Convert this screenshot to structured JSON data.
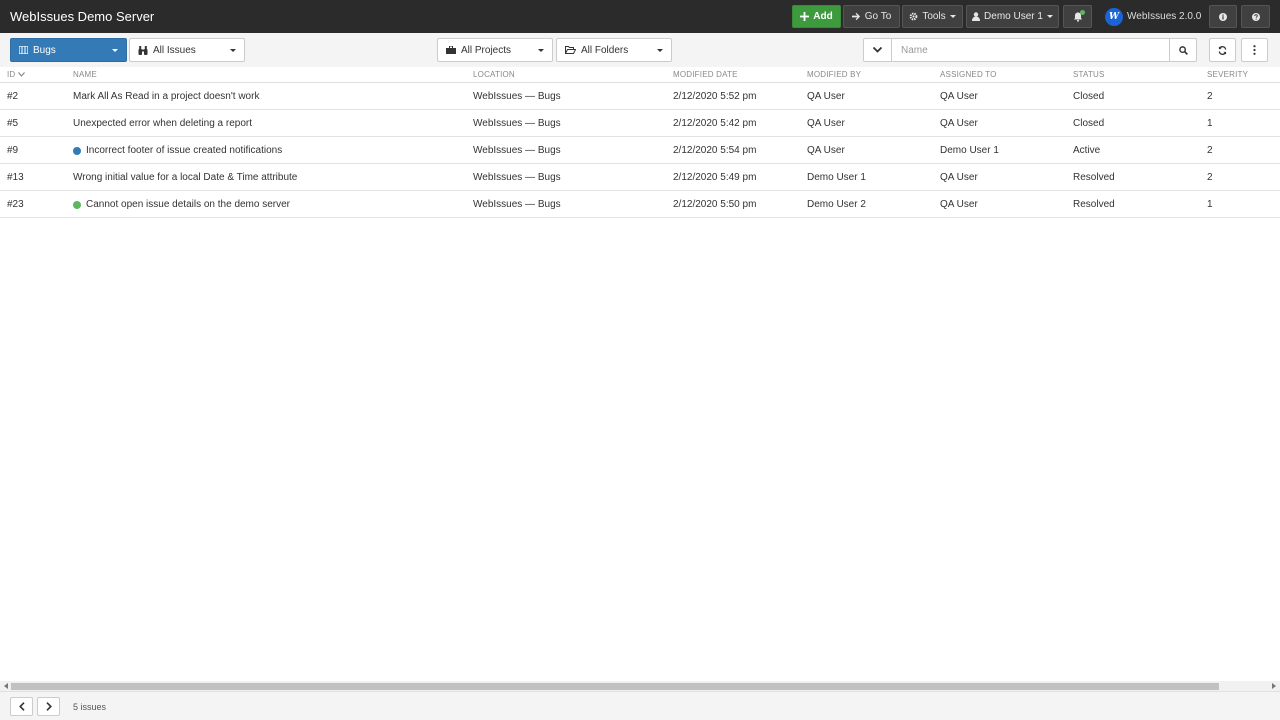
{
  "header": {
    "title": "WebIssues Demo Server",
    "add_label": "Add",
    "goto_label": "Go To",
    "tools_label": "Tools",
    "user_label": "Demo User 1",
    "brand_logo": "W",
    "brand_label": "WebIssues 2.0.0"
  },
  "toolbar": {
    "view_label": "Bugs",
    "filter_label": "All Issues",
    "projects_label": "All Projects",
    "folders_label": "All Folders",
    "search_placeholder": "Name"
  },
  "table": {
    "columns": {
      "id": "ID",
      "name": "Name",
      "location": "Location",
      "modified_date": "Modified Date",
      "modified_by": "Modified By",
      "assigned_to": "Assigned To",
      "status": "Status",
      "severity": "Severity"
    },
    "rows": [
      {
        "id": "#2",
        "name": "Mark All As Read in a project doesn't work",
        "location": "WebIssues — Bugs",
        "modified_date": "2/12/2020 5:52 pm",
        "modified_by": "QA User",
        "assigned_to": "QA User",
        "status": "Closed",
        "severity": "2"
      },
      {
        "id": "#5",
        "name": "Unexpected error when deleting a report",
        "location": "WebIssues — Bugs",
        "modified_date": "2/12/2020 5:42 pm",
        "modified_by": "QA User",
        "assigned_to": "QA User",
        "status": "Closed",
        "severity": "1"
      },
      {
        "id": "#9",
        "name": "Incorrect footer of issue created notifications",
        "location": "WebIssues — Bugs",
        "modified_date": "2/12/2020 5:54 pm",
        "modified_by": "QA User",
        "assigned_to": "Demo User 1",
        "status": "Active",
        "severity": "2"
      },
      {
        "id": "#13",
        "name": "Wrong initial value for a local Date & Time attribute",
        "location": "WebIssues — Bugs",
        "modified_date": "2/12/2020 5:49 pm",
        "modified_by": "Demo User 1",
        "assigned_to": "QA User",
        "status": "Resolved",
        "severity": "2"
      },
      {
        "id": "#23",
        "name": "Cannot open issue details on the demo server",
        "location": "WebIssues — Bugs",
        "modified_date": "2/12/2020 5:50 pm",
        "modified_by": "Demo User 2",
        "assigned_to": "QA User",
        "status": "Resolved",
        "severity": "1"
      }
    ]
  },
  "row_markers": {
    "#9": {
      "type": "unread-dot",
      "color": "#337ab7"
    },
    "#23": {
      "type": "new-dot",
      "color": "#5cb85c"
    }
  },
  "footer": {
    "count_label": "5 issues"
  },
  "colors": {
    "header_bg": "#2b2b2b",
    "add_button": "#3d9b3d",
    "primary_button": "#337ab7"
  }
}
